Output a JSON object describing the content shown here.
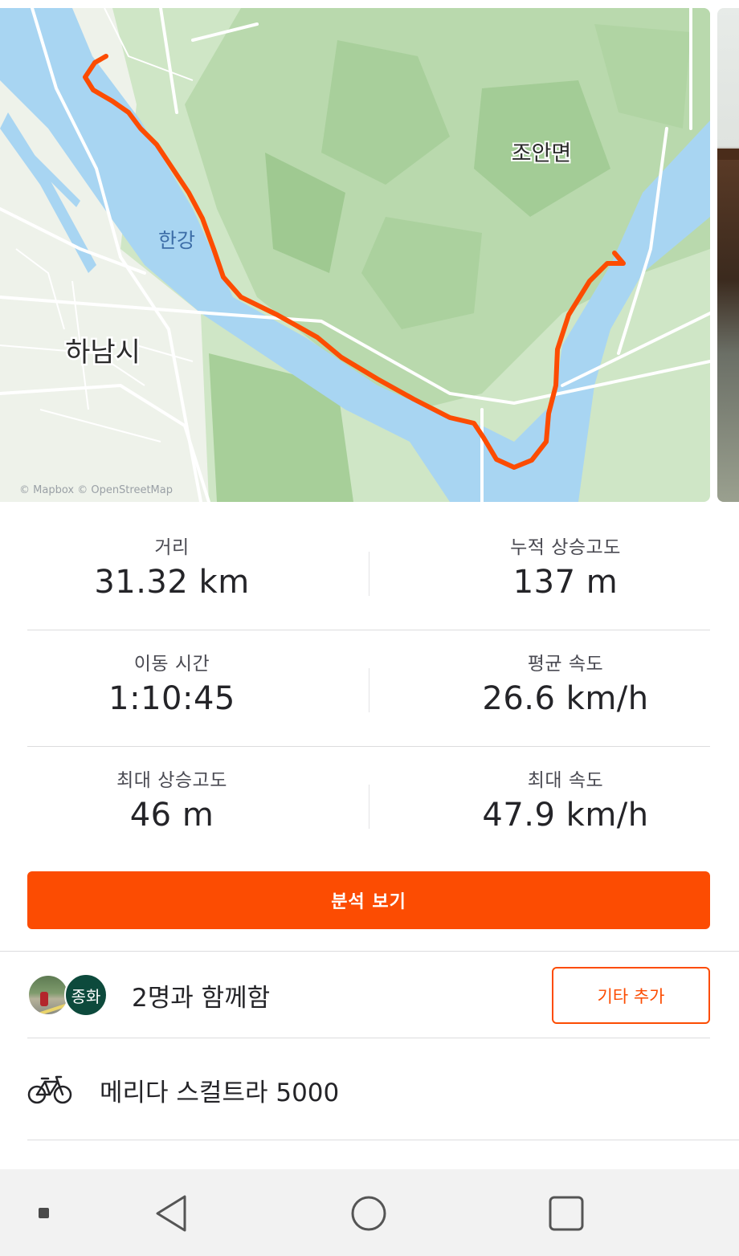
{
  "map": {
    "place_labels": {
      "joan": "조안면",
      "hangang": "한강",
      "hanam": "하남시"
    },
    "attribution": "© Mapbox © OpenStreetMap",
    "route_color": "#fc4c02"
  },
  "stats": [
    {
      "label": "거리",
      "value": "31.32 km"
    },
    {
      "label": "누적 상승고도",
      "value": "137 m"
    },
    {
      "label": "이동 시간",
      "value": "1:10:45"
    },
    {
      "label": "평균 속도",
      "value": "26.6 km/h"
    },
    {
      "label": "최대 상승고도",
      "value": "46 m"
    },
    {
      "label": "최대 속도",
      "value": "47.9 km/h"
    }
  ],
  "analysis_button": "분석 보기",
  "group": {
    "avatar_initial": "종화",
    "text": "2명과 함께함",
    "add_button": "기타 추가"
  },
  "bike": {
    "name": "메리다 스컬트라 5000",
    "icon": "bike-icon"
  },
  "navbar": {
    "icons": [
      "square-dot-icon",
      "back-icon",
      "home-icon",
      "recents-icon"
    ]
  },
  "colors": {
    "accent": "#fc4c02",
    "avatar_bg": "#0d4a3c",
    "water": "#a8d5f2",
    "land": "#cfe6c6"
  }
}
